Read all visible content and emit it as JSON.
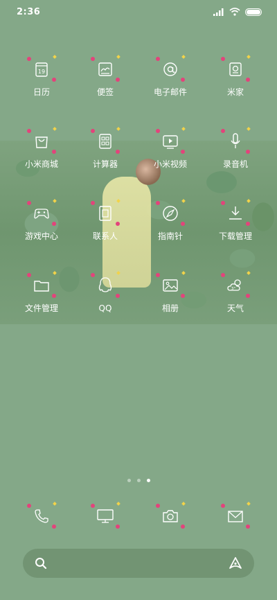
{
  "status_bar": {
    "time": "2:36",
    "icons": [
      "signal-icon",
      "wifi-icon",
      "battery-icon"
    ]
  },
  "apps": [
    {
      "label": "日历",
      "icon": "calendar-icon",
      "badge_text": "19"
    },
    {
      "label": "便签",
      "icon": "notes-icon"
    },
    {
      "label": "电子邮件",
      "icon": "email-at-icon"
    },
    {
      "label": "米家",
      "icon": "mijia-icon"
    },
    {
      "label": "小米商城",
      "icon": "shopping-bag-icon"
    },
    {
      "label": "计算器",
      "icon": "calculator-icon"
    },
    {
      "label": "小米视频",
      "icon": "video-play-icon"
    },
    {
      "label": "录音机",
      "icon": "microphone-icon"
    },
    {
      "label": "游戏中心",
      "icon": "gamepad-icon"
    },
    {
      "label": "联系人",
      "icon": "contacts-icon"
    },
    {
      "label": "指南针",
      "icon": "compass-icon"
    },
    {
      "label": "下载管理",
      "icon": "download-icon"
    },
    {
      "label": "文件管理",
      "icon": "folder-icon"
    },
    {
      "label": "QQ",
      "icon": "qq-penguin-icon"
    },
    {
      "label": "相册",
      "icon": "gallery-icon"
    },
    {
      "label": "天气",
      "icon": "weather-icon",
      "badge_text": "3°"
    }
  ],
  "page_indicator": {
    "count": 3,
    "active_index": 2
  },
  "dock": [
    {
      "icon": "phone-icon"
    },
    {
      "icon": "desktop-icon"
    },
    {
      "icon": "camera-icon"
    },
    {
      "icon": "mail-envelope-icon"
    }
  ],
  "search_bar": {
    "left_icon": "search-icon",
    "right_icon": "assistant-icon"
  },
  "colors": {
    "background": "#84a888",
    "text": "#ffffff",
    "accent_heart": "#e3437b",
    "accent_star": "#f2d34a"
  }
}
